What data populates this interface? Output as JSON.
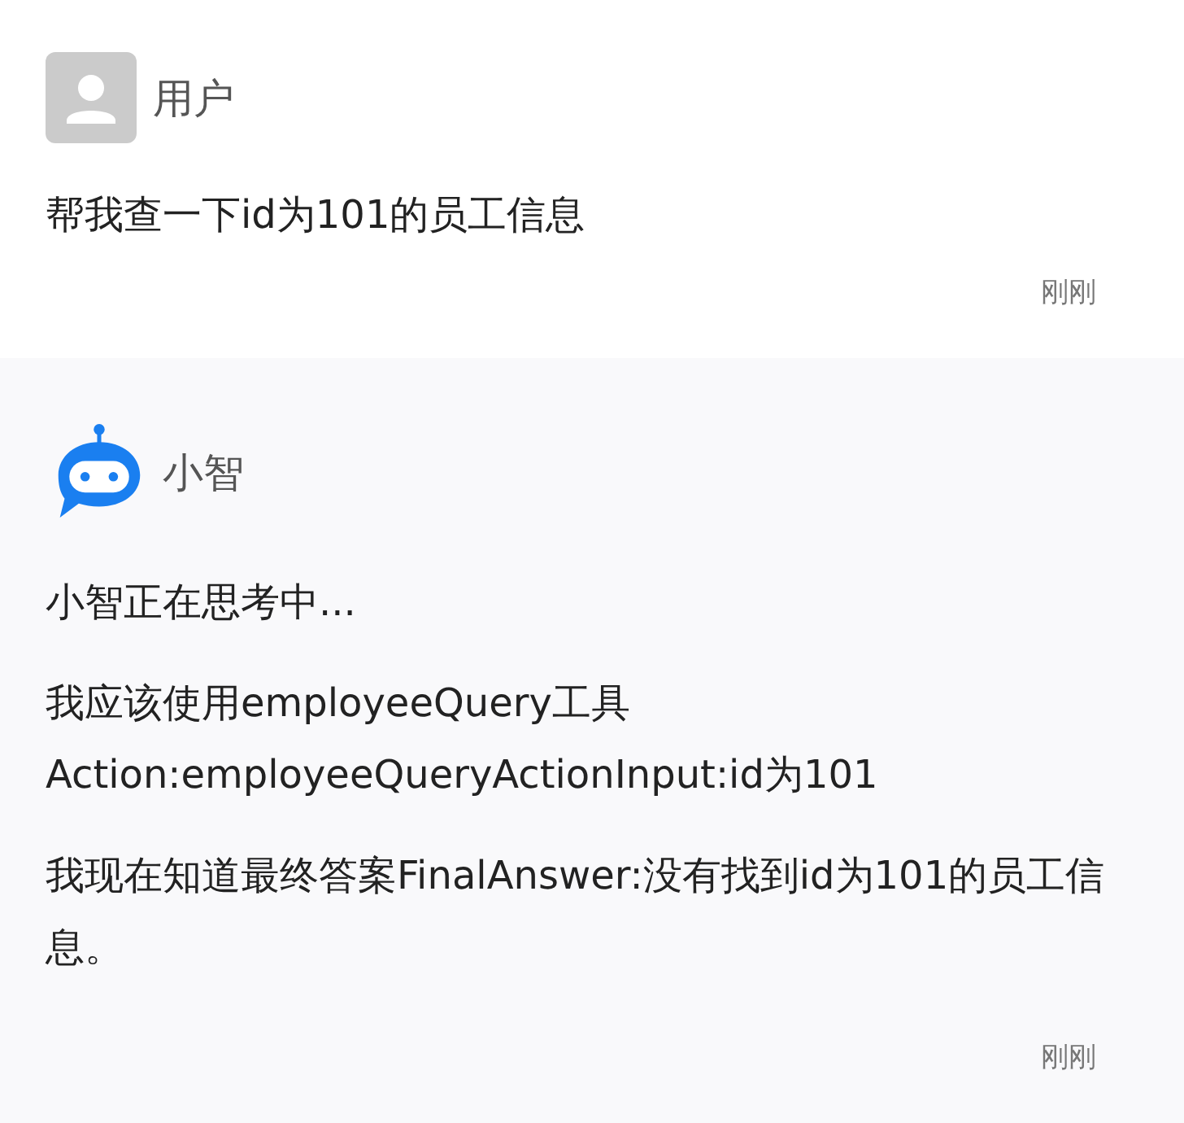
{
  "messages": [
    {
      "kind": "user",
      "sender": "用户",
      "paragraphs": [
        "帮我查一下id为101的员工信息"
      ],
      "time": "刚刚"
    },
    {
      "kind": "bot",
      "sender": "小智",
      "paragraphs": [
        "小智正在思考中...",
        "我应该使用employeeQuery工具\nAction:employeeQueryActionInput:id为101",
        "我现在知道最终答案FinalAnswer:没有找到id为101的员工信息。"
      ],
      "time": "刚刚"
    }
  ]
}
